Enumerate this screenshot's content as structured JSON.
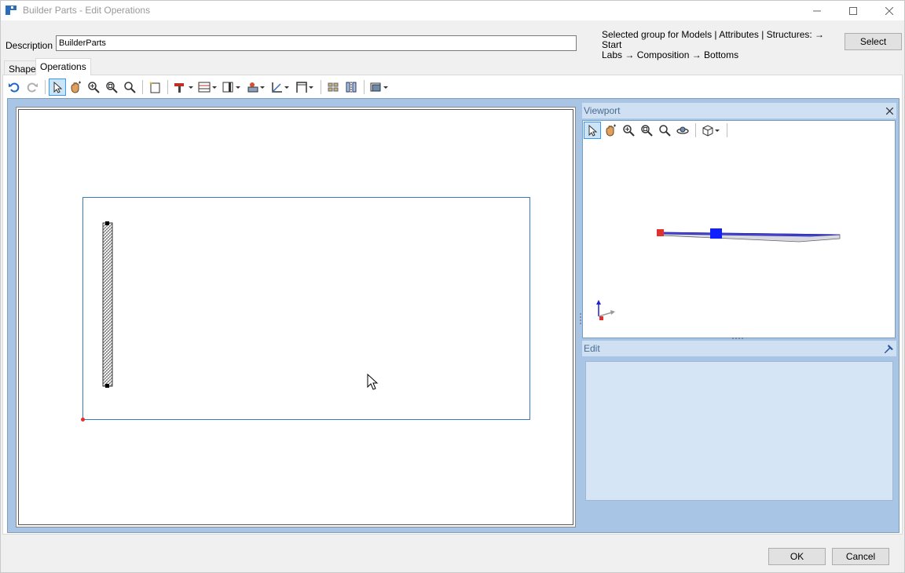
{
  "window": {
    "title": "Builder Parts - Edit Operations"
  },
  "description": {
    "label": "Description",
    "value": "BuilderParts"
  },
  "group_info": {
    "line1": "Selected group for Models | Attributes | Structures:  → Start",
    "line2": "Labs → Composition → Bottoms"
  },
  "select_button": "Select",
  "tabs": [
    {
      "label": "Shape",
      "active": false
    },
    {
      "label": "Operations",
      "active": true
    }
  ],
  "toolbar_icons": [
    "undo-icon",
    "redo-icon",
    "pointer-icon",
    "pan-icon",
    "zoom-in-icon",
    "zoom-extents-icon",
    "zoom-out-icon",
    "new-note-icon",
    "drill-icon",
    "slot-icon",
    "pocket-icon",
    "tool-icon",
    "measure-icon",
    "gauge-icon",
    "array-icon",
    "align-icon",
    "view-icon"
  ],
  "viewport": {
    "title": "Viewport",
    "toolbar_icons": [
      "pointer-icon",
      "pan-icon",
      "zoom-in-icon",
      "zoom-extents-icon",
      "zoom-out-icon",
      "orbit-icon",
      "view-cube-icon"
    ]
  },
  "edit_panel": {
    "title": "Edit"
  },
  "buttons": {
    "ok": "OK",
    "cancel": "Cancel"
  },
  "colors": {
    "accent": "#3399ff",
    "panel_bg": "#a9c5e6",
    "part_blue": "#0000ff",
    "origin_red": "#e03030"
  }
}
